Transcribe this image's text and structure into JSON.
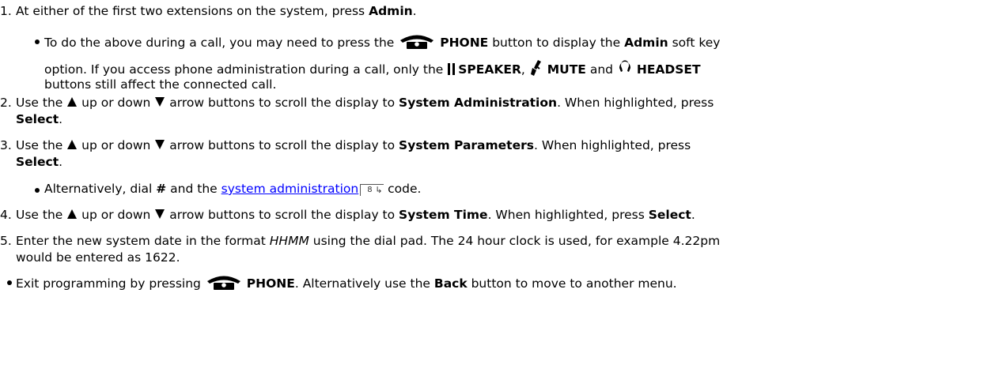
{
  "steps": [
    {
      "num": "1.",
      "parts": [
        "At either of the first two extensions on the system, press ",
        "Admin",
        "."
      ]
    },
    {
      "num": "2.",
      "parts": [
        "Use the ",
        " up or down ",
        " arrow buttons to scroll the display to ",
        "System Administration",
        ". When highlighted, press",
        "Select",
        "."
      ]
    },
    {
      "num": "3.",
      "parts": [
        "Use the ",
        " up or down ",
        " arrow buttons to scroll the display to ",
        "System Parameters",
        ". When highlighted, press",
        "Select",
        "."
      ]
    },
    {
      "num": "4.",
      "parts": [
        "Use the ",
        " up or down ",
        " arrow buttons to scroll the display to ",
        "System Time",
        ". When highlighted, press ",
        "Select",
        "."
      ]
    },
    {
      "num": "5.",
      "parts": [
        "Enter the new system date in the format ",
        "HHMM",
        " using the dial pad. The 24 hour clock is used, for example 4.22pm",
        "would be entered as 1622."
      ]
    }
  ],
  "sub1": [
    "To do the above during a call, you may need to press the ",
    "PHONE",
    " button to display the ",
    "Admin",
    " soft key",
    "option. If you access phone administration during a call, only the ",
    "SPEAKER",
    ", ",
    "MUTE",
    " and ",
    "HEADSET",
    "buttons still affect the connected call."
  ],
  "sub3": [
    "Alternatively, dial ",
    "#",
    " and the ",
    "system administration",
    "8",
    " code."
  ],
  "exit": [
    "Exit programming by pressing ",
    "PHONE",
    ". Alternatively use the ",
    "Back",
    " button to move to another menu."
  ],
  "icons": {
    "phone": "phone-icon",
    "speaker": "speaker-icon",
    "mute": "mute-icon",
    "headset": "headset-icon",
    "up": "up-arrow-icon",
    "down": "down-arrow-icon",
    "xref": "page-reference-icon"
  }
}
